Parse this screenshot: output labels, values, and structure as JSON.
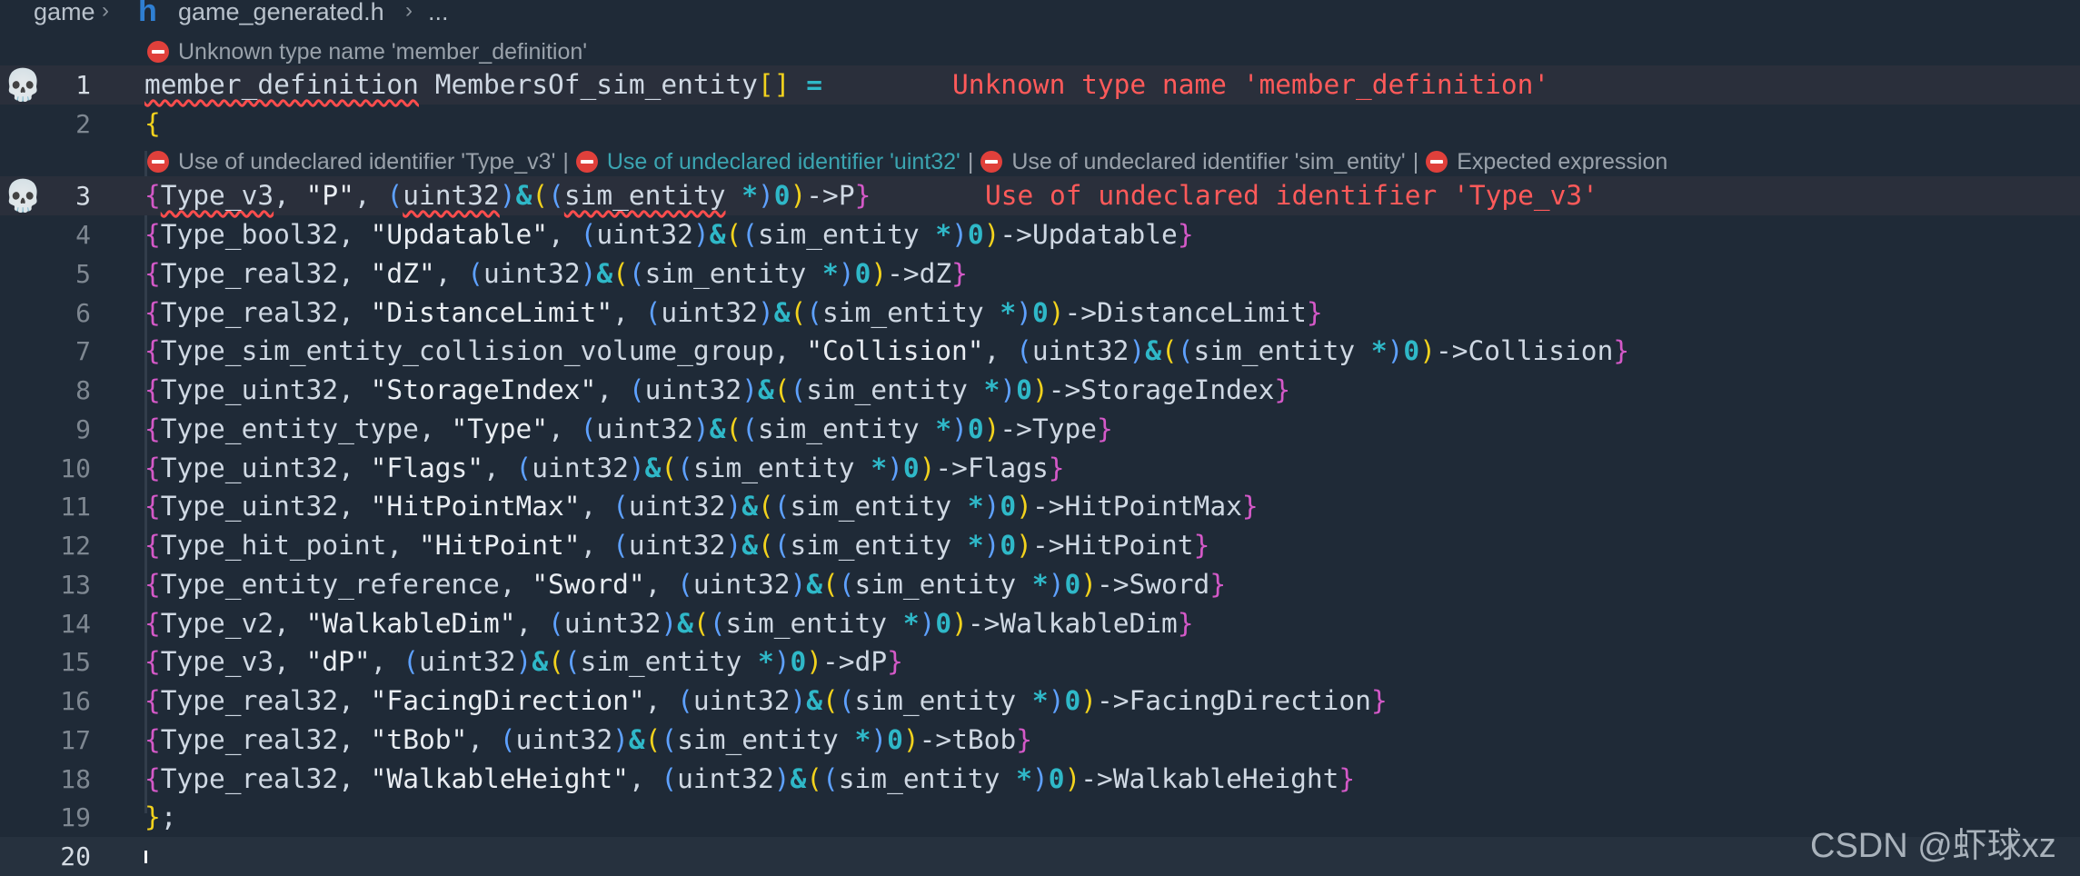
{
  "breadcrumb": {
    "folder": "game",
    "file_icon": "h",
    "file": "game_generated.h",
    "more": "..."
  },
  "lens": {
    "line1": "Unknown type name 'member_definition'",
    "line3": [
      "Use of undeclared identifier 'Type_v3'",
      "Use of undeclared identifier 'uint32'",
      "Use of undeclared identifier 'sim_entity'",
      "Expected expression"
    ],
    "separator": "|"
  },
  "inline_errors": {
    "line1": "Unknown type name 'member_definition'",
    "line3": "Use of undeclared identifier 'Type_v3'"
  },
  "gutter_icon": "skull-icon",
  "line_numbers": [
    "1",
    "2",
    "3",
    "4",
    "5",
    "6",
    "7",
    "8",
    "9",
    "10",
    "11",
    "12",
    "13",
    "14",
    "15",
    "16",
    "17",
    "18",
    "19",
    "20"
  ],
  "code": {
    "line1": {
      "type": "member_definition",
      "name": " MembersOf_sim_entity",
      "brackets": "[]",
      "eq": " ="
    },
    "line2": "{",
    "members": [
      {
        "type": "Type_v3",
        "name": "\"P\"",
        "field": "P"
      },
      {
        "type": "Type_bool32",
        "name": "\"Updatable\"",
        "field": "Updatable"
      },
      {
        "type": "Type_real32",
        "name": "\"dZ\"",
        "field": "dZ"
      },
      {
        "type": "Type_real32",
        "name": "\"DistanceLimit\"",
        "field": "DistanceLimit"
      },
      {
        "type": "Type_sim_entity_collision_volume_group",
        "name": "\"Collision\"",
        "field": "Collision"
      },
      {
        "type": "Type_uint32",
        "name": "\"StorageIndex\"",
        "field": "StorageIndex"
      },
      {
        "type": "Type_entity_type",
        "name": "\"Type\"",
        "field": "Type"
      },
      {
        "type": "Type_uint32",
        "name": "\"Flags\"",
        "field": "Flags"
      },
      {
        "type": "Type_uint32",
        "name": "\"HitPointMax\"",
        "field": "HitPointMax"
      },
      {
        "type": "Type_hit_point",
        "name": "\"HitPoint\"",
        "field": "HitPoint"
      },
      {
        "type": "Type_entity_reference",
        "name": "\"Sword\"",
        "field": "Sword"
      },
      {
        "type": "Type_v2",
        "name": "\"WalkableDim\"",
        "field": "WalkableDim"
      },
      {
        "type": "Type_v3",
        "name": "\"dP\"",
        "field": "dP"
      },
      {
        "type": "Type_real32",
        "name": "\"FacingDirection\"",
        "field": "FacingDirection"
      },
      {
        "type": "Type_real32",
        "name": "\"tBob\"",
        "field": "tBob"
      },
      {
        "type": "Type_real32",
        "name": "\"WalkableHeight\"",
        "field": "WalkableHeight"
      }
    ],
    "line19": "};",
    "cast_type": "uint32",
    "struct_type": "sim_entity",
    "zero": "0",
    "arrow": "->"
  },
  "watermark": "CSDN @虾球xz",
  "colors": {
    "background": "#1f2a37",
    "error": "#ff5a5a",
    "brace": "#d459c8",
    "paren": "#5ea1ff",
    "operator": "#2fb8c8",
    "bracket_yellow": "#f2d21d"
  }
}
